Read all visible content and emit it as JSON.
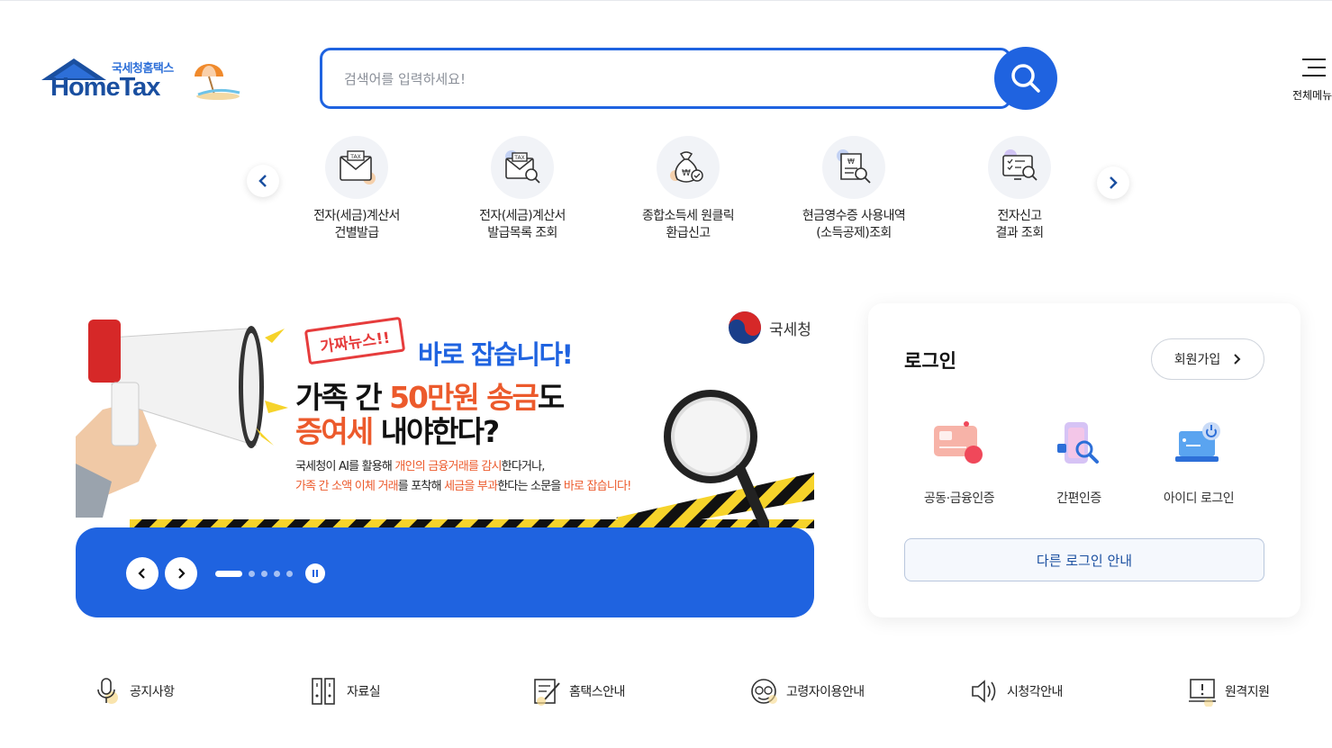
{
  "header": {
    "logo_sub": "국세청홈택스",
    "logo_main": "HomeTax",
    "search_placeholder": "검색어를 입력하세요!",
    "menu_label": "전체메뉴"
  },
  "quick_menu": [
    {
      "line1": "전자(세금)계산서",
      "line2": "건별발급"
    },
    {
      "line1": "전자(세금)계산서",
      "line2": "발급목록 조회"
    },
    {
      "line1": "종합소득세 원클릭",
      "line2": "환급신고"
    },
    {
      "line1": "현금영수증 사용내역",
      "line2": "(소득공제)조회"
    },
    {
      "line1": "전자신고",
      "line2": "결과 조회"
    }
  ],
  "banner": {
    "agency": "국세청",
    "tag": "가짜뉴스!!",
    "headline1": "바로 잡습니다!",
    "headline2_a": "가족 간 ",
    "headline2_b": "50만원 송금",
    "headline2_c": "도",
    "headline3_a": "증여세",
    "headline3_b": " 내야한다?",
    "desc1_a": "국세청이 AI를 활용해 ",
    "desc1_b": "개인의 금융거래를 감시",
    "desc1_c": "한다거나,",
    "desc2_a": "가족 간 소액 이체 거래",
    "desc2_b": "를 포착해 ",
    "desc2_c": "세금을 부과",
    "desc2_d": "한다는 소문을 ",
    "desc2_e": "바로 잡습니다!",
    "slide_count": 5,
    "active_slide": 1
  },
  "login": {
    "title": "로그인",
    "join_label": "회원가입",
    "options": [
      "공동·금융인증",
      "간편인증",
      "아이디 로그인"
    ],
    "other_label": "다른 로그인 안내"
  },
  "bottom_links": [
    "공지사항",
    "자료실",
    "홈택스안내",
    "고령자이용안내",
    "시청각안내",
    "원격지원"
  ],
  "colors": {
    "primary": "#1f63e0",
    "accent": "#ec5a2c",
    "logo": "#1a4fa0"
  }
}
